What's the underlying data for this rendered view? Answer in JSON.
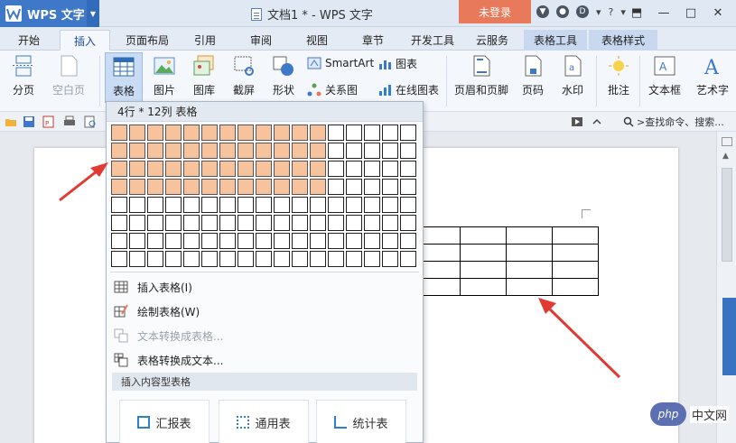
{
  "titlebar": {
    "app_label": "WPS 文字",
    "doc_title": "文档1 * - WPS 文字",
    "login_label": "未登录",
    "help_label": "?"
  },
  "tabs": [
    {
      "label": "开始"
    },
    {
      "label": "插入"
    },
    {
      "label": "页面布局"
    },
    {
      "label": "引用"
    },
    {
      "label": "审阅"
    },
    {
      "label": "视图"
    },
    {
      "label": "章节"
    },
    {
      "label": "开发工具"
    },
    {
      "label": "云服务"
    },
    {
      "label": "表格工具"
    },
    {
      "label": "表格样式"
    }
  ],
  "ribbon": {
    "page_break": "分页",
    "blank_page": "空白页",
    "table": "表格",
    "picture": "图片",
    "gallery": "图库",
    "screenshot": "截屏",
    "shape": "形状",
    "smartart": "SmartArt",
    "chart": "图表",
    "relation": "关系图",
    "online_chart": "在线图表",
    "header_footer": "页眉和页脚",
    "page_number": "页码",
    "watermark": "水印",
    "comment": "批注",
    "textbox": "文本框",
    "wordart": "艺术字"
  },
  "qbar": {
    "search_text": ">查找命令、搜索..."
  },
  "dropdown": {
    "header": "4行 * 12列 表格",
    "grid": {
      "rows": 8,
      "cols": 17,
      "selected_rows": 4,
      "selected_cols": 12
    },
    "items": [
      {
        "label": "插入表格(I)",
        "disabled": false
      },
      {
        "label": "绘制表格(W)",
        "disabled": false
      },
      {
        "label": "文本转换成表格...",
        "disabled": true
      },
      {
        "label": "表格转换成文本...",
        "disabled": false
      }
    ],
    "section_title": "插入内容型表格",
    "templates": [
      {
        "label": "汇报表"
      },
      {
        "label": "通用表"
      },
      {
        "label": "统计表"
      }
    ]
  },
  "watermark": {
    "logo": "php",
    "text": "中文网"
  },
  "colors": {
    "accent": "#3f78c8",
    "login": "#e8795a",
    "selected_cell": "#f6c39c",
    "arrow": "#e03a32"
  }
}
